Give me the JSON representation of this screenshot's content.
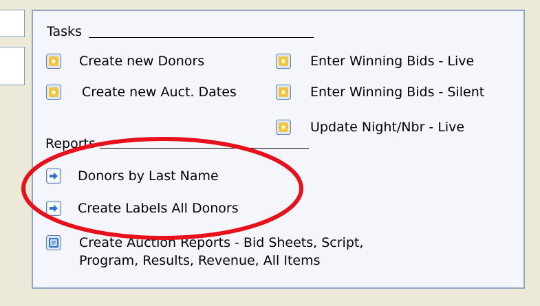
{
  "tasks": {
    "heading": "Tasks",
    "items": [
      {
        "label": "Create new Donors",
        "icon": "form-icon"
      },
      {
        "label": "Create new Auct. Dates",
        "icon": "form-icon"
      },
      {
        "label": "Enter Winning Bids - Live",
        "icon": "form-icon"
      },
      {
        "label": "Enter Winning Bids - Silent",
        "icon": "form-icon"
      },
      {
        "label": "Update Night/Nbr - Live",
        "icon": "form-icon"
      }
    ]
  },
  "reports": {
    "heading": "Reports",
    "items": [
      {
        "label": "Donors by Last Name",
        "icon": "arrow-right-icon"
      },
      {
        "label": "Create Labels All Donors",
        "icon": "arrow-right-icon"
      },
      {
        "label": "Create Auction Reports - Bid Sheets, Script, Program, Results, Revenue, All Items",
        "icon": "report-form-icon"
      }
    ]
  },
  "colors": {
    "background": "#ece9d8",
    "panel": "#f4f6fb",
    "panel_border": "#8fa6c2",
    "annotation": "#e8101a",
    "icon_yellow": "#f5c842",
    "icon_blue": "#2f6fd6"
  }
}
